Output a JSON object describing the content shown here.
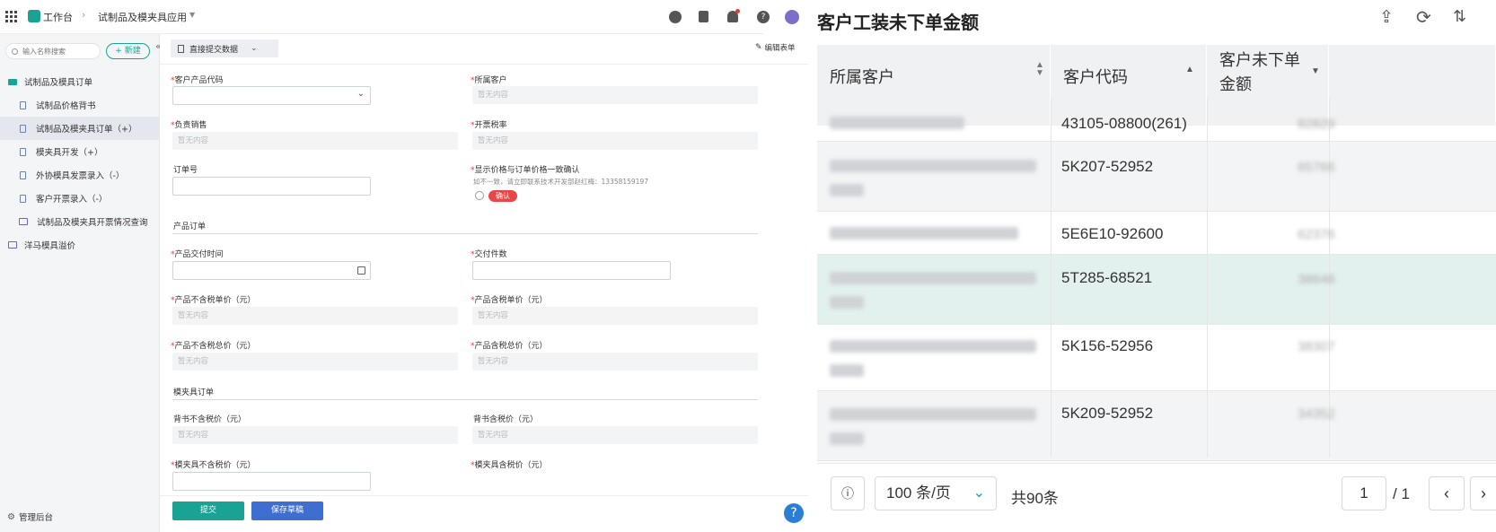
{
  "topbar": {
    "workspace": "工作台",
    "app_name": "试制品及模夹具应用",
    "icons": [
      "compass-icon",
      "book-icon",
      "bell-icon",
      "help-icon",
      "avatar"
    ]
  },
  "sidebar": {
    "search_placeholder": "输入名称搜索",
    "new_button": "+ 新建",
    "group": "试制品及模具订单",
    "items": [
      {
        "label": "试制品价格背书"
      },
      {
        "label": "试制品及模夹具订单（+）"
      },
      {
        "label": "模夹具开发（+）"
      },
      {
        "label": "外协模具发票录入（-）"
      },
      {
        "label": "客户开票录入（-）"
      },
      {
        "label": "试制品及模夹具开票情况查询"
      }
    ],
    "group2": "洋马模具溢价",
    "footer": "管理后台"
  },
  "form": {
    "mode_label": "直接提交数据",
    "edit_form": "编辑表单",
    "fields": {
      "customer_product_code": "客户产品代码",
      "customer": "所属客户",
      "sales": "负责销售",
      "tax_rate": "开票税率",
      "order_no": "订单号",
      "price_confirm": "显示价格与订单价格一致确认",
      "price_hint": "如不一致，请立即联系技术开发部赵红梅：13358159197",
      "confirm_tag": "确认",
      "section_product": "产品订单",
      "delivery_time": "产品交付时间",
      "delivery_qty": "交付件数",
      "unit_price_ex": "产品不含税单价（元）",
      "unit_price_in": "产品含税单价（元）",
      "total_ex": "产品不含税总价（元）",
      "total_in": "产品含税总价（元）",
      "section_mold": "模夹具订单",
      "endorse_ex": "背书不含税价（元）",
      "endorse_in": "背书含税价（元）",
      "mold_ex": "模夹具不含税价（元）",
      "mold_in": "模夹具含税价（元）",
      "empty": "暂无内容"
    },
    "submit": "提交",
    "save_draft": "保存草稿"
  },
  "panel": {
    "title": "客户工装未下单金额",
    "columns": [
      "所属客户",
      "客户代码",
      "客户未下单金额"
    ],
    "rows": [
      {
        "code": "43105-08800(261)",
        "amount": "82829"
      },
      {
        "code": "5K207-52952",
        "amount": "65766"
      },
      {
        "code": "5E6E10-92600",
        "amount": "62376"
      },
      {
        "code": "5T285-68521",
        "amount": "38646"
      },
      {
        "code": "5K156-52956",
        "amount": "38307"
      },
      {
        "code": "5K209-52952",
        "amount": "34352"
      }
    ],
    "page_size": "100 条/页",
    "total": "共90条",
    "page_current": "1",
    "page_total": "/ 1"
  }
}
